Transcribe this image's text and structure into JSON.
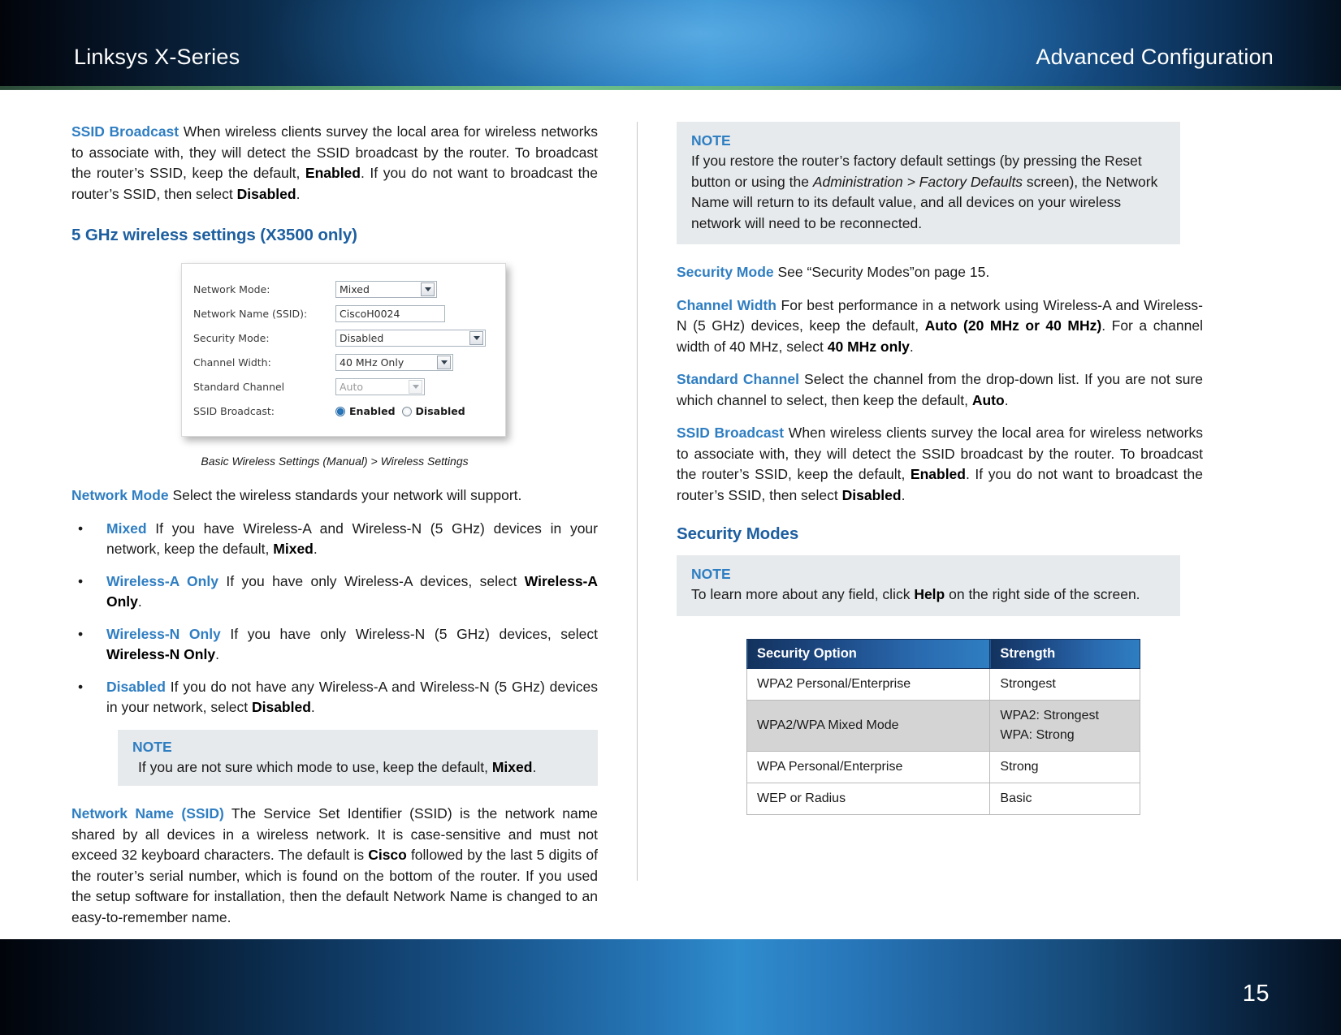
{
  "header": {
    "left_title": "Linksys X-Series",
    "right_title": "Advanced Configuration"
  },
  "footer": {
    "page_number": "15"
  },
  "left_column": {
    "ssid_broadcast": {
      "lead": "SSID Broadcast",
      "text_1": " When wireless clients survey the local area for wireless networks to associate with, they will detect the SSID broadcast by the router. To broadcast the router’s SSID, keep the default, ",
      "bold_1": "Enabled",
      "text_2": ". If you do not want to broadcast the router’s SSID, then select ",
      "bold_2": "Disabled",
      "text_3": "."
    },
    "section_heading": "5 GHz wireless settings (X3500 only)",
    "screenshot": {
      "rows": [
        {
          "label": "Network Mode:",
          "value": "Mixed",
          "control": "dropdown"
        },
        {
          "label": "Network Name (SSID):",
          "value": "CiscoH0024",
          "control": "text"
        },
        {
          "label": "Security Mode:",
          "value": "Disabled",
          "control": "dropdown"
        },
        {
          "label": "Channel Width:",
          "value": "40 MHz Only",
          "control": "dropdown"
        },
        {
          "label": "Standard Channel",
          "value": "Auto",
          "control": "dropdown-disabled"
        },
        {
          "label": "SSID Broadcast:",
          "value": "",
          "control": "radio"
        }
      ],
      "radio_enabled_label": "Enabled",
      "radio_disabled_label": "Disabled",
      "radio_selected": "Enabled",
      "caption": "Basic Wireless Settings (Manual) > Wireless Settings"
    },
    "network_mode": {
      "lead": "Network Mode",
      "text": "  Select the wireless standards your network will support."
    },
    "bullets": [
      {
        "bullet": "•",
        "lead": "Mixed",
        "text_1": " If you have Wireless-A and Wireless-N (5 GHz) devices in your network, keep the default, ",
        "bold_1": "Mixed",
        "text_2": "."
      },
      {
        "bullet": "•",
        "lead": "Wireless-A Only",
        "text_1": "  If you have only Wireless-A devices, select ",
        "bold_1": "Wireless-A Only",
        "text_2": "."
      },
      {
        "bullet": "•",
        "lead": "Wireless-N Only",
        "text_1": " If you have only Wireless-N (5 GHz) devices, select ",
        "bold_1": "Wireless-N Only",
        "text_2": "."
      },
      {
        "bullet": "•",
        "lead": "Disabled",
        "text_1": "  If you do not have any Wireless-A and Wireless-N (5 GHz) devices in your network, select ",
        "bold_1": "Disabled",
        "text_2": "."
      }
    ],
    "note_mode": {
      "title": "NOTE",
      "text_1": "If you are not sure which mode to use, keep the default, ",
      "bold_1": "Mixed",
      "text_2": "."
    },
    "network_name": {
      "lead": "Network Name (SSID)",
      "text_1": "  The Service Set Identifier (SSID) is the network name shared by all devices in a wireless network. It is case-sensitive and must not exceed 32 keyboard characters. The default is ",
      "bold_1": "Cisco",
      "text_2": " followed by the last 5 digits of the router’s serial number, which is found on the bottom of the router. If you used the setup software for installation, then the default Network Name is changed to an easy-to-remember name."
    }
  },
  "right_column": {
    "note_factory": {
      "title": "NOTE",
      "text_1": "If you restore the router’s factory default settings (by pressing the Reset button or using the ",
      "italic_1": "Administration > Factory Defaults",
      "text_2": " screen), the Network Name will return to its default value, and all devices on your wireless network will need to be reconnected."
    },
    "security_mode": {
      "lead": "Security Mode",
      "text": "  See “Security Modes”on page 15."
    },
    "channel_width": {
      "lead": "Channel Width",
      "text_1": " For best performance in a network using Wireless-A and Wireless-N (5 GHz) devices, keep the default, ",
      "bold_1": "Auto (20 MHz or 40 MHz)",
      "text_2": ". For a channel width of 40 MHz, select ",
      "bold_2": "40 MHz only",
      "text_3": "."
    },
    "standard_channel": {
      "lead": "Standard Channel",
      "text_1": "  Select the channel from the drop-down list. If you are not sure which channel to select, then keep the default, ",
      "bold_1": "Auto",
      "text_2": "."
    },
    "ssid_broadcast": {
      "lead": "SSID Broadcast",
      "text_1": " When wireless clients survey the local area for wireless networks to associate with, they will detect the SSID broadcast by the router. To broadcast the router’s SSID, keep the default, ",
      "bold_1": "Enabled",
      "text_2": ". If you do not want to broadcast the router’s SSID, then select ",
      "bold_2": "Disabled",
      "text_3": "."
    },
    "security_modes_heading": "Security Modes",
    "note_help": {
      "title": "NOTE",
      "text_1": "To learn more about any field, click ",
      "bold_1": "Help",
      "text_2": " on the right side of the screen."
    },
    "table": {
      "headers": [
        "Security Option",
        "Strength"
      ],
      "rows": [
        {
          "option": "WPA2 Personal/Enterprise",
          "strength": "Strongest",
          "strength_line2": ""
        },
        {
          "option": "WPA2/WPA Mixed Mode",
          "strength": "WPA2: Strongest",
          "strength_line2": "WPA: Strong"
        },
        {
          "option": "WPA Personal/Enterprise",
          "strength": "Strong",
          "strength_line2": ""
        },
        {
          "option": "WEP or Radius",
          "strength": "Basic",
          "strength_line2": ""
        }
      ]
    }
  },
  "colors": {
    "accent_blue": "#2f7ec2",
    "heading_blue": "#1d5fa0",
    "note_bg": "#e7eaec",
    "table_header_dark": "#13325e",
    "table_row_shaded": "#d4d4d4"
  }
}
